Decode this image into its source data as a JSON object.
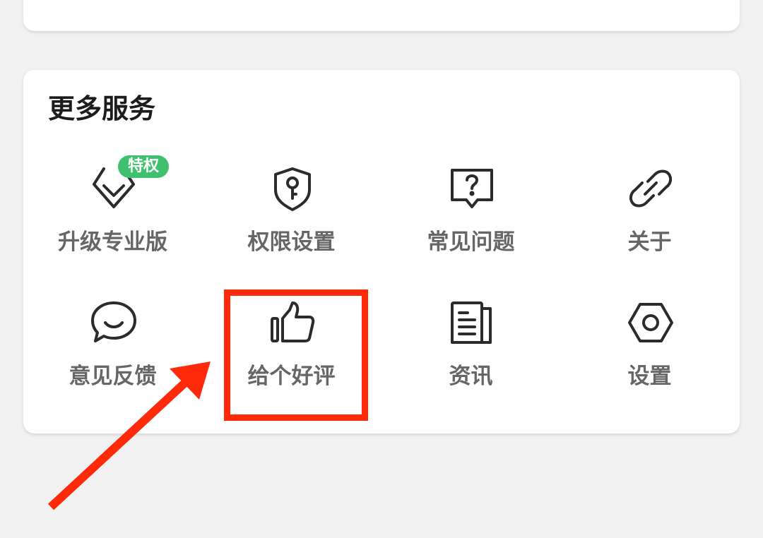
{
  "more_services": {
    "title": "更多服务",
    "items": [
      {
        "label": "升级专业版",
        "icon": "diamond-icon",
        "badge": "特权"
      },
      {
        "label": "权限设置",
        "icon": "shield-key-icon"
      },
      {
        "label": "常见问题",
        "icon": "question-bubble-icon"
      },
      {
        "label": "关于",
        "icon": "link-icon"
      },
      {
        "label": "意见反馈",
        "icon": "chat-bubble-icon"
      },
      {
        "label": "给个好评",
        "icon": "thumbs-up-icon"
      },
      {
        "label": "资讯",
        "icon": "news-icon"
      },
      {
        "label": "设置",
        "icon": "hex-nut-icon"
      }
    ]
  },
  "colors": {
    "icon_stroke": "#2b2b2b",
    "label": "#666666",
    "badge_bg": "#3fc06e",
    "annotation_red": "#ff2a0a"
  }
}
